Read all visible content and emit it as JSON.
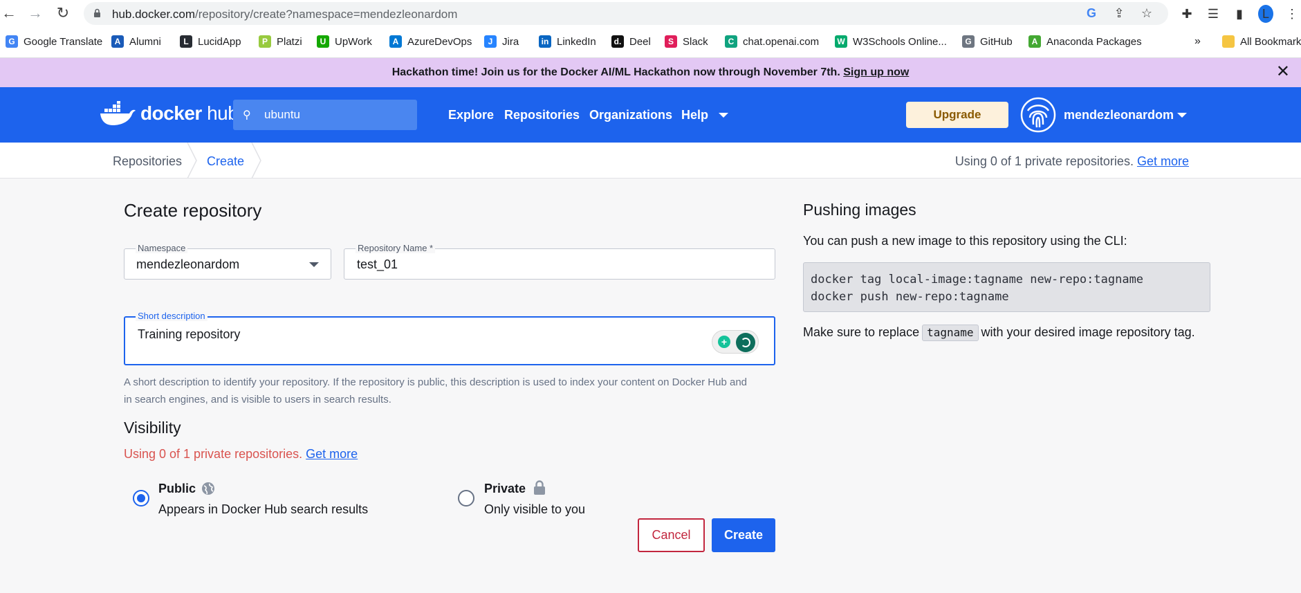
{
  "browser": {
    "url_host": "hub.docker.com",
    "url_path": "/repository/create?namespace=mendezleonardom",
    "profile_initial": "L",
    "bookmarks": [
      {
        "label": "Google Translate",
        "color": "#4285f4",
        "glyph": "G"
      },
      {
        "label": "Alumni",
        "color": "#1a5bb8",
        "glyph": "A"
      },
      {
        "label": "LucidApp",
        "color": "#282c33",
        "glyph": "L"
      },
      {
        "label": "Platzi",
        "color": "#98ca3f",
        "glyph": "P"
      },
      {
        "label": "UpWork",
        "color": "#14a800",
        "glyph": "U"
      },
      {
        "label": "AzureDevOps",
        "color": "#0078d4",
        "glyph": "A"
      },
      {
        "label": "Jira",
        "color": "#2684ff",
        "glyph": "J"
      },
      {
        "label": "LinkedIn",
        "color": "#0a66c2",
        "glyph": "in"
      },
      {
        "label": "Deel",
        "color": "#111111",
        "glyph": "d."
      },
      {
        "label": "Slack",
        "color": "#e01e5a",
        "glyph": "S"
      },
      {
        "label": "chat.openai.com",
        "color": "#10a37f",
        "glyph": "C"
      },
      {
        "label": "W3Schools Online...",
        "color": "#04aa6d",
        "glyph": "W"
      },
      {
        "label": "GitHub",
        "color": "#6e7681",
        "glyph": "G"
      },
      {
        "label": "Anaconda Packages",
        "color": "#44a833",
        "glyph": "A"
      }
    ],
    "more_bookmarks": "»",
    "all_bookmarks": "All Bookmark"
  },
  "banner": {
    "text": "Hackathon time! Join us for the Docker AI/ML Hackathon now through November 7th.",
    "link": "Sign up now"
  },
  "header": {
    "logo_docker": "docker",
    "logo_hub": "hub",
    "search_value": "ubuntu",
    "nav": [
      "Explore",
      "Repositories",
      "Organizations",
      "Help"
    ],
    "upgrade": "Upgrade",
    "username": "mendezleonardom"
  },
  "breadcrumb": {
    "items": [
      "Repositories",
      "Create"
    ],
    "private_usage": "Using 0 of 1 private repositories.",
    "get_more": "Get more"
  },
  "form": {
    "title": "Create repository",
    "namespace_label": "Namespace",
    "namespace_value": "mendezleonardom",
    "repo_name_label": "Repository Name *",
    "repo_name_value": "test_01",
    "short_desc_label": "Short description",
    "short_desc_value": "Training repository",
    "helper": "A short description to identify your repository. If the repository is public, this description is used to index your content on Docker Hub and in search engines, and is visible to users in search results.",
    "visibility_title": "Visibility",
    "visibility_usage": "Using 0 of 1 private repositories.",
    "visibility_get_more": "Get more",
    "public_title": "Public",
    "public_sub": "Appears in Docker Hub search results",
    "private_title": "Private",
    "private_sub": "Only visible to you",
    "selected_visibility": "public",
    "cancel": "Cancel",
    "create": "Create"
  },
  "pushing": {
    "title": "Pushing images",
    "intro": "You can push a new image to this repository using the CLI:",
    "code_line1": "docker tag local-image:tagname new-repo:tagname",
    "code_line2": "docker push new-repo:tagname",
    "note_before": "Make sure to replace",
    "note_code": "tagname",
    "note_after": "with your desired image repository tag."
  },
  "colors": {
    "docker_blue": "#1d63ed",
    "banner_bg": "#e3c8f4",
    "upgrade_bg": "#fdf1dc",
    "cancel_red": "#c2263e",
    "usage_red": "#d9534f"
  }
}
